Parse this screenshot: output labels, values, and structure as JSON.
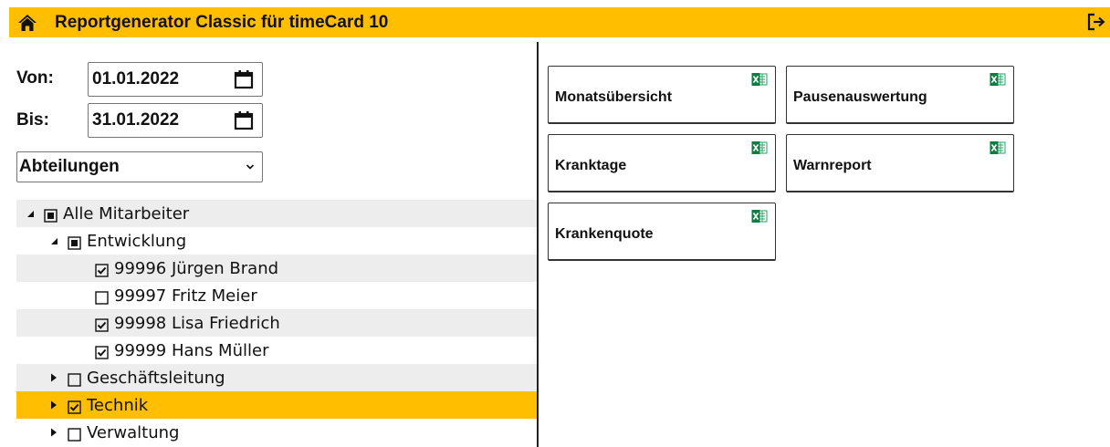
{
  "header": {
    "title": "Reportgenerator Classic für timeCard 10",
    "home_icon": "home-icon",
    "logout_icon": "logout-icon",
    "accent_color": "#ffbf00"
  },
  "filters": {
    "from_label": "Von:",
    "from_value": "01.01.2022",
    "to_label": "Bis:",
    "to_value": "31.01.2022",
    "calendar_icon": "calendar-icon",
    "dept_select_value": "Abteilungen"
  },
  "tree": {
    "rows": [
      {
        "label": "Alle Mitarbeiter",
        "level": 0,
        "expander": "expanded",
        "check": "partial"
      },
      {
        "label": "Entwicklung",
        "level": 1,
        "expander": "expanded",
        "check": "partial"
      },
      {
        "label": "99996 Jürgen Brand",
        "level": 2,
        "expander": "none",
        "check": "checked"
      },
      {
        "label": "99997 Fritz Meier",
        "level": 2,
        "expander": "none",
        "check": "unchecked"
      },
      {
        "label": "99998 Lisa Friedrich",
        "level": 2,
        "expander": "none",
        "check": "checked"
      },
      {
        "label": "99999 Hans Müller",
        "level": 2,
        "expander": "none",
        "check": "checked"
      },
      {
        "label": "Geschäftsleitung",
        "level": 1,
        "expander": "collapsed",
        "check": "unchecked"
      },
      {
        "label": "Technik",
        "level": 1,
        "expander": "collapsed",
        "check": "checked",
        "selected": true
      },
      {
        "label": "Verwaltung",
        "level": 1,
        "expander": "collapsed",
        "check": "unchecked"
      }
    ]
  },
  "reports": {
    "tiles": [
      {
        "label": "Monatsübersicht",
        "icon": "excel-icon"
      },
      {
        "label": "Pausenauswertung",
        "icon": "excel-icon"
      },
      {
        "label": "Kranktage",
        "icon": "excel-icon"
      },
      {
        "label": "Warnreport",
        "icon": "excel-icon"
      },
      {
        "label": "Krankenquote",
        "icon": "excel-icon"
      }
    ]
  }
}
